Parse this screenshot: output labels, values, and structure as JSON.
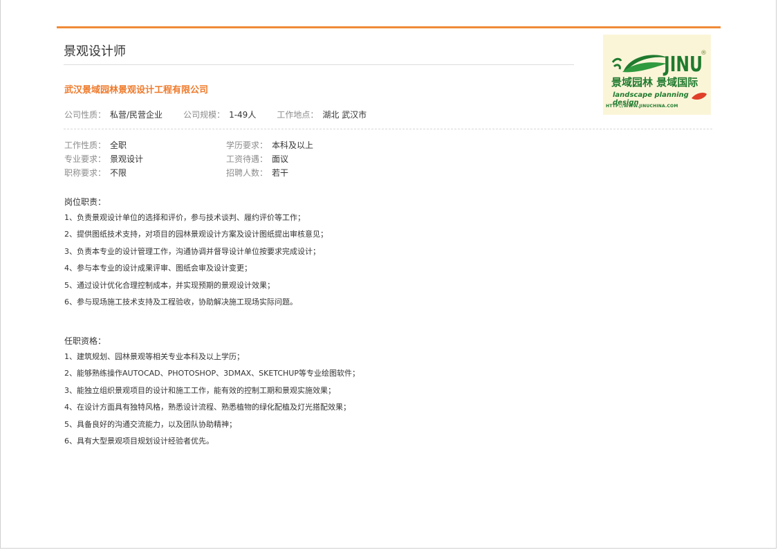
{
  "job": {
    "title": "景观设计师",
    "company": "武汉景域园林景观设计工程有限公司"
  },
  "company_meta": [
    {
      "label": "公司性质：",
      "value": "私营/民营企业"
    },
    {
      "label": "公司规模：",
      "value": "1-49人"
    },
    {
      "label": "工作地点：",
      "value": "湖北 武汉市"
    }
  ],
  "requirements": [
    {
      "label": "工作性质：",
      "value": "全职"
    },
    {
      "label": "学历要求：",
      "value": "本科及以上"
    },
    {
      "label": "专业要求：",
      "value": "景观设计"
    },
    {
      "label": "工资待遇：",
      "value": "面议"
    },
    {
      "label": "职称要求：",
      "value": "不限"
    },
    {
      "label": "招聘人数：",
      "value": "若干"
    }
  ],
  "duties": {
    "heading": "岗位职责：",
    "items": [
      "1、负责景观设计单位的选择和评价，参与技术谈判、履约评价等工作；",
      "2、提供图纸技术支持，对项目的园林景观设计方案及设计图纸提出审核意见；",
      "3、负责本专业的设计管理工作，沟通协调并督导设计单位按要求完成设计；",
      "4、参与本专业的设计成果评审、图纸会审及设计变更；",
      "5、通过设计优化合理控制成本，并实现预期的景观设计效果；",
      "6、参与现场施工技术支持及工程验收，协助解决施工现场实际问题。"
    ]
  },
  "qualifications": {
    "heading": "任职资格：",
    "items": [
      "1、建筑规划、园林景观等相关专业本科及以上学历；",
      "2、能够熟练操作AUTOCAD、PHOTOSHOP、3DMAX、SKETCHUP等专业绘图软件；",
      "3、能独立组织景观项目的设计和施工工作，能有效的控制工期和景观实施效果；",
      "4、在设计方面具有独特风格，熟悉设计流程、熟悉植物的绿化配植及灯光搭配效果；",
      "5、具备良好的沟通交流能力，以及团队协助精神；",
      "6、具有大型景观项目规划设计经验者优先。"
    ]
  },
  "logo": {
    "name": "JINU",
    "reg": "®",
    "cn": "景域园林 景域国际",
    "en": "landscape planning design",
    "url": "HTTP://WWW.JINUCHINA.COM",
    "colors": {
      "green": "#1f7a2e",
      "leaf_red": "#e0402a",
      "background": "#fbf5d8"
    }
  },
  "colors": {
    "accent": "#f08a36",
    "company": "#ee7a2b"
  }
}
